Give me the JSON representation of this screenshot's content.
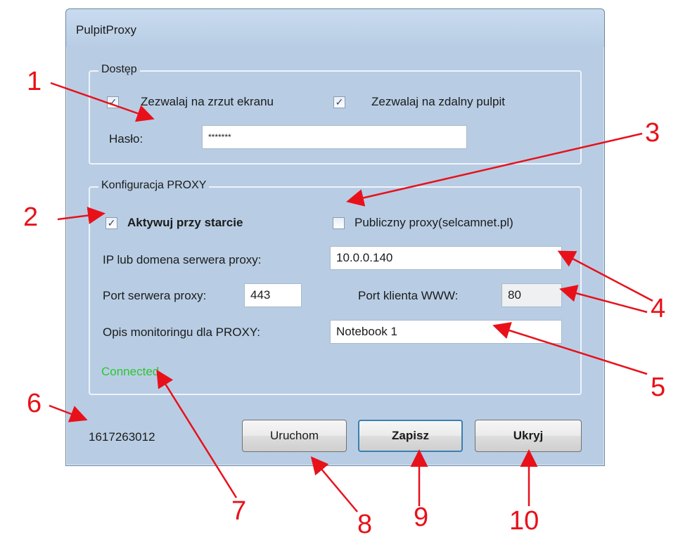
{
  "window": {
    "title": "PulpitProxy"
  },
  "access_group": {
    "legend": "Dostęp",
    "allow_screenshot": {
      "label": "Zezwalaj na zrzut ekranu",
      "checked": true
    },
    "allow_remote": {
      "label": "Zezwalaj na zdalny pulpit",
      "checked": true
    },
    "password_label": "Hasło:",
    "password_value": "*******"
  },
  "proxy_group": {
    "legend": "Konfiguracja PROXY",
    "activate_on_start": {
      "label": "Aktywuj przy starcie",
      "checked": true
    },
    "public_proxy": {
      "label": "Publiczny proxy(selcamnet.pl)",
      "checked": false
    },
    "server_ip_label": "IP lub domena serwera proxy:",
    "server_ip_value": "10.0.0.140",
    "server_port_label": "Port serwera proxy:",
    "server_port_value": "443",
    "client_port_label": "Port klienta WWW:",
    "client_port_value": "80",
    "description_label": "Opis monitoringu dla PROXY:",
    "description_value": "Notebook 1",
    "status_text": "Connected"
  },
  "footer": {
    "id_value": "1617263012",
    "run_button": "Uruchom",
    "save_button": "Zapisz",
    "hide_button": "Ukryj"
  },
  "annotations": [
    "1",
    "2",
    "3",
    "4",
    "5",
    "6",
    "7",
    "8",
    "9",
    "10"
  ],
  "colors": {
    "status_connected": "#2fc42f",
    "annotation": "#e8111a",
    "window_bg": "#b8cde4"
  }
}
